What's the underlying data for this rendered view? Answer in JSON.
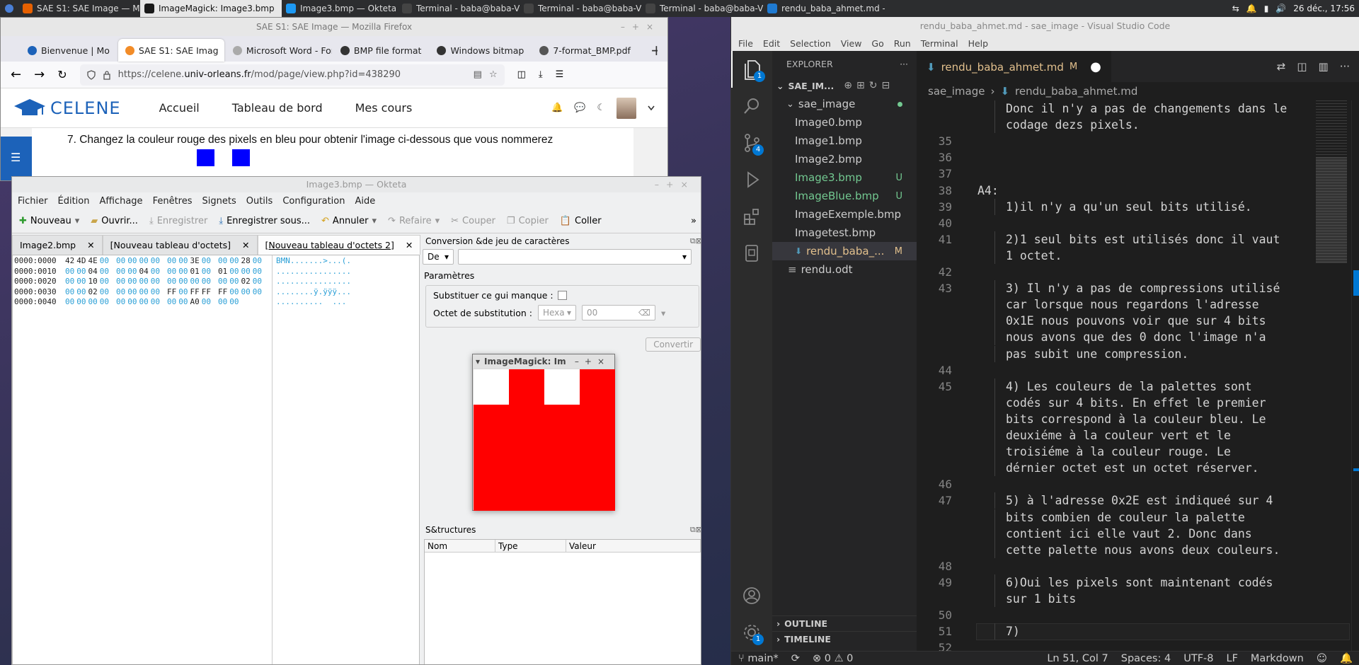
{
  "taskbar": {
    "tasks": [
      {
        "label": "SAE S1: SAE Image — Mozill...",
        "active": false
      },
      {
        "label": "ImageMagick: Image3.bmp",
        "active": true
      },
      {
        "label": "Image3.bmp — Okteta",
        "active": false
      },
      {
        "label": "Terminal - baba@baba-Virtu...",
        "active": false
      },
      {
        "label": "Terminal - baba@baba-Virtu...",
        "active": false
      },
      {
        "label": "Terminal - baba@baba-Virtu...",
        "active": false
      },
      {
        "label": "rendu_baba_ahmet.md - s...",
        "active": false
      }
    ],
    "clock": "26 déc., 17:56"
  },
  "firefox": {
    "window_title": "SAE S1: SAE Image — Mozilla Firefox",
    "tabs": [
      "Bienvenue | Mo",
      "SAE S1: SAE Imag",
      "Microsoft Word - For",
      "BMP file format",
      "Windows bitmap",
      "7-format_BMP.pdf"
    ],
    "url_prefix": "https://celene.",
    "url_domain": "univ-orleans.fr",
    "url_path": "/mod/page/view.php?id=438290",
    "brand": "CELENE",
    "nav": [
      "Accueil",
      "Tableau de bord",
      "Mes cours"
    ],
    "instruction": "7. Changez la couleur rouge des pixels en bleu pour obtenir l'image ci-dessous que vous nommerez"
  },
  "okteta": {
    "window_title": "Image3.bmp — Okteta",
    "menu": [
      "Fichier",
      "Édition",
      "Affichage",
      "Fenêtres",
      "Signets",
      "Outils",
      "Configuration",
      "Aide"
    ],
    "toolbar": {
      "new": "Nouveau",
      "open": "Ouvrir...",
      "save": "Enregistrer",
      "save_as": "Enregistrer sous...",
      "undo": "Annuler",
      "redo": "Refaire",
      "cut": "Couper",
      "copy": "Copier",
      "paste": "Coller"
    },
    "doc_tabs": [
      "Image2.bmp",
      "[Nouveau tableau d'octets]",
      "[Nouveau tableau d'octets 2]"
    ],
    "hex_rows": [
      {
        "addr": "0000:0000",
        "bytes": [
          "42",
          "4D",
          "4E",
          "00",
          "00",
          "00",
          "00",
          "00",
          "00",
          "00",
          "3E",
          "00",
          "00",
          "00",
          "28",
          "00"
        ],
        "chars": "BMN.......>...(."
      },
      {
        "addr": "0000:0010",
        "bytes": [
          "00",
          "00",
          "04",
          "00",
          "00",
          "00",
          "04",
          "00",
          "00",
          "00",
          "01",
          "00",
          "01",
          "00",
          "00",
          "00"
        ],
        "chars": "................"
      },
      {
        "addr": "0000:0020",
        "bytes": [
          "00",
          "00",
          "10",
          "00",
          "00",
          "00",
          "00",
          "00",
          "00",
          "00",
          "00",
          "00",
          "00",
          "00",
          "02",
          "00"
        ],
        "chars": "................"
      },
      {
        "addr": "0000:0030",
        "bytes": [
          "00",
          "00",
          "02",
          "00",
          "00",
          "00",
          "00",
          "00",
          "FF",
          "00",
          "FF",
          "FF",
          "FF",
          "00",
          "00",
          "00"
        ],
        "chars": "........ÿ.ÿÿÿ..."
      },
      {
        "addr": "0000:0040",
        "bytes": [
          "00",
          "00",
          "00",
          "00",
          "00",
          "00",
          "00",
          "00",
          "00",
          "00",
          "A0",
          "00",
          "00",
          "00"
        ],
        "chars": "..........  ..."
      }
    ],
    "conversion": {
      "title": "Conversion &de jeu de caractères",
      "direction": "De",
      "params_label": "Paramètres",
      "substitute_label": "Substituer ce gui manque :",
      "sub_byte_label": "Octet de substitution :",
      "sub_format": "Hexa",
      "sub_value": "00",
      "convert_button": "Convertir"
    },
    "structures": {
      "title": "S&tructures",
      "columns": [
        "Nom",
        "Type",
        "Valeur"
      ]
    }
  },
  "imagemagick": {
    "title": "ImageMagick: Im"
  },
  "vscode": {
    "window_title": "rendu_baba_ahmet.md - sae_image - Visual Studio Code",
    "menu": [
      "File",
      "Edit",
      "Selection",
      "View",
      "Go",
      "Run",
      "Terminal",
      "Help"
    ],
    "explorer_label": "EXPLORER",
    "workspace": "SAE_IM...",
    "folder": "sae_image",
    "files": [
      {
        "name": "Image0.bmp",
        "status": ""
      },
      {
        "name": "Image1.bmp",
        "status": ""
      },
      {
        "name": "Image2.bmp",
        "status": ""
      },
      {
        "name": "Image3.bmp",
        "status": "U"
      },
      {
        "name": "ImageBlue.bmp",
        "status": "U"
      },
      {
        "name": "ImageExemple.bmp",
        "status": ""
      },
      {
        "name": "Imagetest.bmp",
        "status": ""
      },
      {
        "name": "rendu_baba_...",
        "status": "M"
      }
    ],
    "root_file": "rendu.odt",
    "outline": "OUTLINE",
    "timeline": "TIMELINE",
    "active_tab": "rendu_baba_ahmet.md",
    "tab_status": "M",
    "breadcrumb": [
      "sae_image",
      "rendu_baba_ahmet.md"
    ],
    "badges": {
      "explorer": "1",
      "scm": "4",
      "accounts": "1"
    },
    "code_lines": [
      {
        "n": "",
        "indent": 1,
        "text": "Donc il n'y a pas de changements dans le"
      },
      {
        "n": "",
        "indent": 1,
        "text": "codage dezs pixels."
      },
      {
        "n": "35",
        "indent": 0,
        "text": ""
      },
      {
        "n": "36",
        "indent": 0,
        "text": ""
      },
      {
        "n": "37",
        "indent": 0,
        "text": ""
      },
      {
        "n": "38",
        "indent": 0,
        "text": "A4:"
      },
      {
        "n": "39",
        "indent": 1,
        "text": "1)il n'y a qu'un seul bits utilisé."
      },
      {
        "n": "40",
        "indent": 0,
        "text": ""
      },
      {
        "n": "41",
        "indent": 1,
        "text": "2)1 seul bits est utilisés donc il vaut"
      },
      {
        "n": "",
        "indent": 1,
        "text": "1 octet."
      },
      {
        "n": "42",
        "indent": 0,
        "text": ""
      },
      {
        "n": "43",
        "indent": 1,
        "text": "3) Il n'y a pas de compressions utilisé"
      },
      {
        "n": "",
        "indent": 1,
        "text": "car lorsque nous regardons l'adresse"
      },
      {
        "n": "",
        "indent": 1,
        "text": "0x1E nous pouvons voir que sur 4 bits"
      },
      {
        "n": "",
        "indent": 1,
        "text": "nous avons que des 0 donc l'image n'a"
      },
      {
        "n": "",
        "indent": 1,
        "text": "pas subit une compression."
      },
      {
        "n": "44",
        "indent": 0,
        "text": ""
      },
      {
        "n": "45",
        "indent": 1,
        "text": "4) Les couleurs de la palettes sont"
      },
      {
        "n": "",
        "indent": 1,
        "text": "codés sur 4 bits. En effet le premier"
      },
      {
        "n": "",
        "indent": 1,
        "text": "bits correspond à la couleur bleu. Le"
      },
      {
        "n": "",
        "indent": 1,
        "text": "deuxiéme à la couleur vert et le"
      },
      {
        "n": "",
        "indent": 1,
        "text": "troisiéme à la couleur rouge. Le"
      },
      {
        "n": "",
        "indent": 1,
        "text": "dérnier octet est un octet réserver."
      },
      {
        "n": "46",
        "indent": 0,
        "text": ""
      },
      {
        "n": "47",
        "indent": 1,
        "text": "5) à l'adresse 0x2E est indiqueé sur 4"
      },
      {
        "n": "",
        "indent": 1,
        "text": "bits combien de couleur la palette"
      },
      {
        "n": "",
        "indent": 1,
        "text": "contient ici elle vaut 2. Donc dans"
      },
      {
        "n": "",
        "indent": 1,
        "text": "cette palette nous avons deux couleurs."
      },
      {
        "n": "48",
        "indent": 0,
        "text": ""
      },
      {
        "n": "49",
        "indent": 1,
        "text": "6)Oui les pixels sont maintenant codés"
      },
      {
        "n": "",
        "indent": 1,
        "text": "sur 1 bits"
      },
      {
        "n": "50",
        "indent": 0,
        "text": ""
      },
      {
        "n": "51",
        "indent": 1,
        "text": "7)"
      },
      {
        "n": "52",
        "indent": 0,
        "text": ""
      }
    ],
    "status": {
      "branch": "main*",
      "errors": "0",
      "warnings": "0",
      "position": "Ln 51, Col 7",
      "spaces": "Spaces: 4",
      "encoding": "UTF-8",
      "eol": "LF",
      "language": "Markdown"
    }
  },
  "colors": {
    "vscode_accent": "#0078d4",
    "git_untracked": "#73c991",
    "git_modified": "#e2c08d",
    "hex_zero": "#2a9fd6",
    "image_red": "#ff0000",
    "celene_blue": "#1c62b9"
  }
}
